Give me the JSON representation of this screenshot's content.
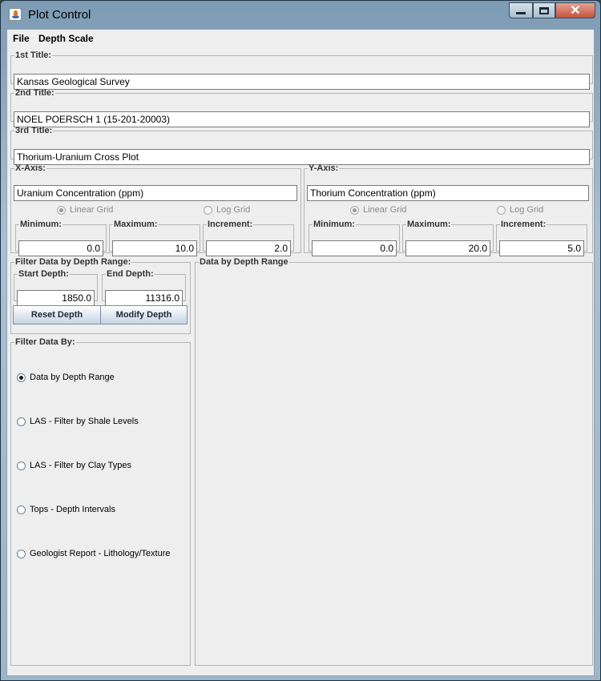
{
  "window": {
    "title": "Plot Control"
  },
  "menu": {
    "file": "File",
    "depth_scale": "Depth Scale"
  },
  "titles": {
    "first_label": "1st Title:",
    "first_value": "Kansas Geological Survey",
    "second_label": "2nd Title:",
    "second_value": "NOEL POERSCH 1 (15-201-20003)",
    "third_label": "3rd Title:",
    "third_value": "Thorium-Uranium Cross Plot"
  },
  "x_axis": {
    "label": "X-Axis:",
    "title_value": "Uranium Concentration (ppm)",
    "linear_grid": "Linear Grid",
    "log_grid": "Log Grid",
    "grid_selected": "linear",
    "min_label": "Minimum:",
    "min_value": "0.0",
    "max_label": "Maximum:",
    "max_value": "10.0",
    "inc_label": "Increment:",
    "inc_value": "2.0"
  },
  "y_axis": {
    "label": "Y-Axis:",
    "title_value": "Thorium Concentration (ppm)",
    "linear_grid": "Linear Grid",
    "log_grid": "Log Grid",
    "grid_selected": "linear",
    "min_label": "Minimum:",
    "min_value": "0.0",
    "max_label": "Maximum:",
    "max_value": "20.0",
    "inc_label": "Increment:",
    "inc_value": "5.0"
  },
  "depth_filter": {
    "label": "Filter Data by Depth Range:",
    "start_label": "Start Depth:",
    "start_value": "1850.0",
    "end_label": "End Depth:",
    "end_value": "11316.0",
    "reset_button": "Reset Depth",
    "modify_button": "Modify Depth"
  },
  "filter_by": {
    "label": "Filter Data By:",
    "options": [
      {
        "label": "Data by Depth Range",
        "selected": true
      },
      {
        "label": "LAS - Filter by Shale Levels",
        "selected": false
      },
      {
        "label": "LAS - Filter by Clay Types",
        "selected": false
      },
      {
        "label": "Tops - Depth Intervals",
        "selected": false
      },
      {
        "label": "Geologist Report - Lithology/Texture",
        "selected": false
      }
    ]
  },
  "panel": {
    "label": "Data by Depth Range"
  },
  "colors": {
    "button_gradient_top": "#ffffff",
    "button_gradient_bottom": "#c9d6e4",
    "panel_bg": "#eeeeee"
  }
}
